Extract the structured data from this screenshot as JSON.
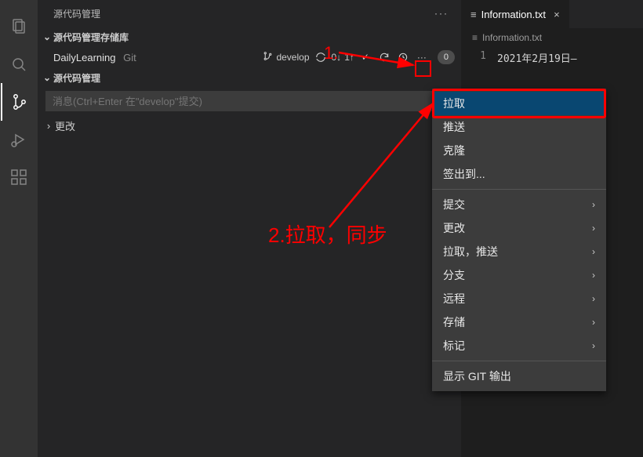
{
  "panel": {
    "title": "源代码管理"
  },
  "sections": {
    "repos": "源代码管理存储库",
    "scm": "源代码管理"
  },
  "repo": {
    "name": "DailyLearning",
    "kind": "Git",
    "branch": "develop",
    "incoming": "0↓",
    "outgoing": "1↑",
    "count": "0"
  },
  "commit": {
    "placeholder": "消息(Ctrl+Enter 在\"develop\"提交)"
  },
  "changes": {
    "label": "更改"
  },
  "editor": {
    "tab": "Information.txt",
    "breadcrumb": "Information.txt",
    "line_number": "1",
    "line_content": "2021年2月19日—"
  },
  "menu": {
    "pull": "拉取",
    "push": "推送",
    "clone": "克隆",
    "checkout": "签出到...",
    "commit": "提交",
    "changes": "更改",
    "pull_push": "拉取，推送",
    "branch": "分支",
    "remote": "远程",
    "stash": "存储",
    "tag": "标记",
    "show_git_output": "显示 GIT 输出"
  },
  "annotations": {
    "step1": "1.",
    "step2": "2.拉取，同步"
  }
}
